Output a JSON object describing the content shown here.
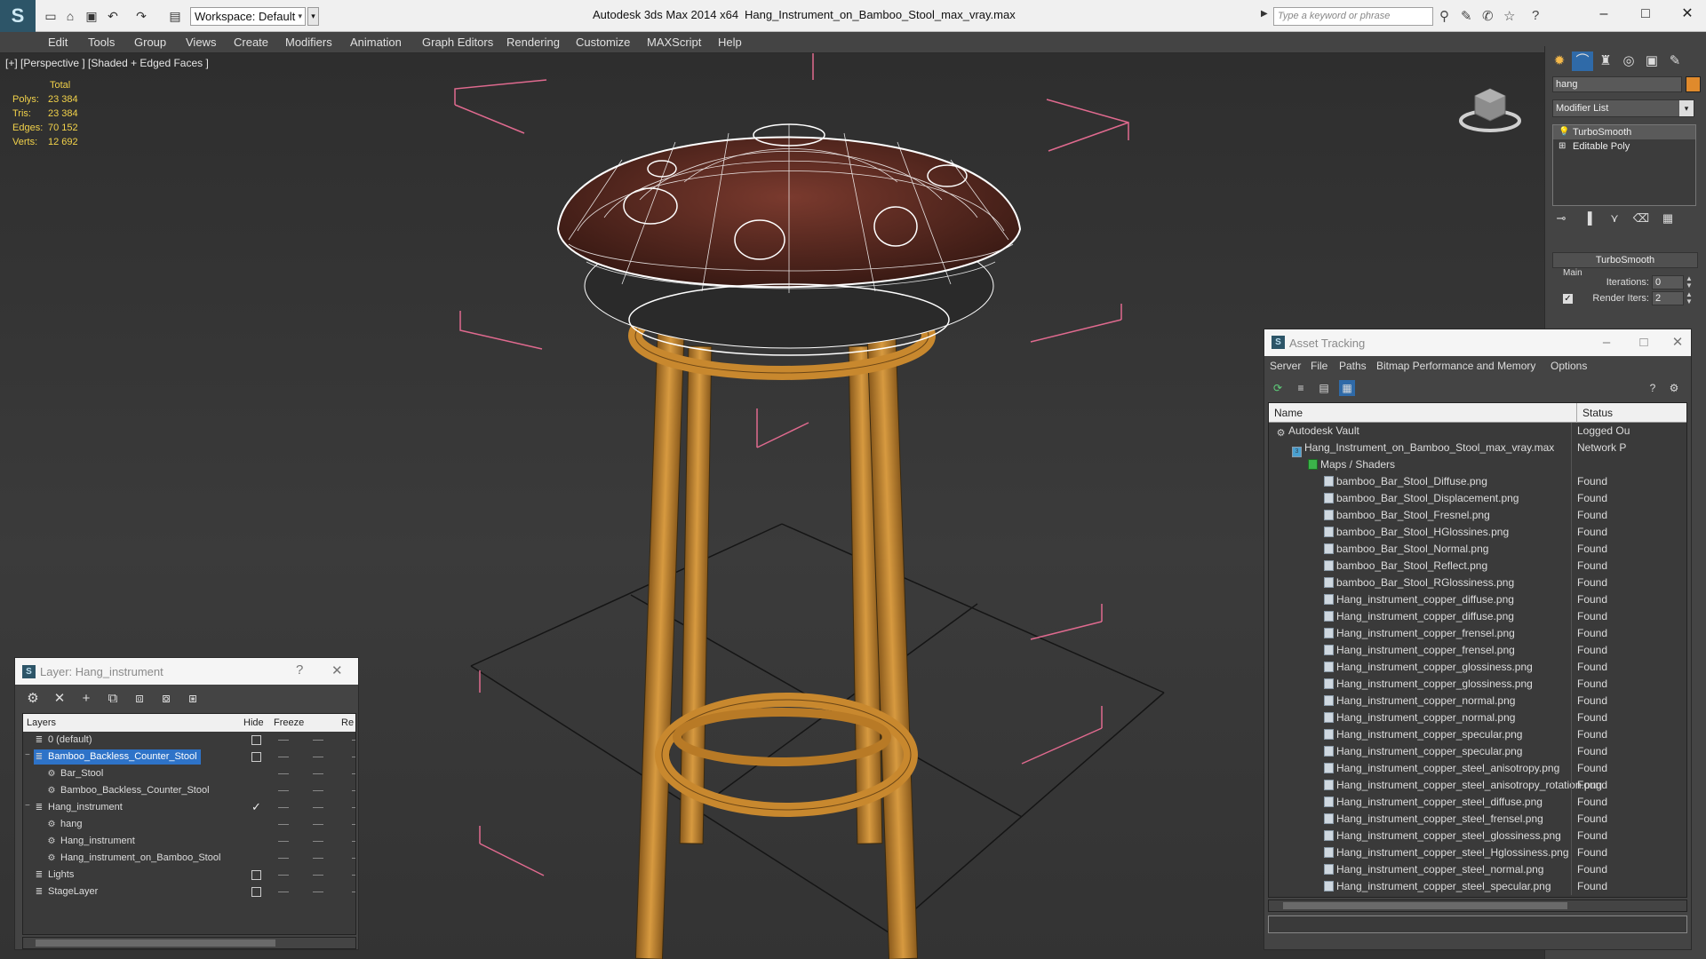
{
  "titlebar": {
    "app_title": "Autodesk 3ds Max  2014 x64",
    "file_title": "Hang_Instrument_on_Bamboo_Stool_max_vray.max",
    "workspace": "Workspace: Default",
    "search_placeholder": "Type a keyword or phrase"
  },
  "menubar": [
    "Edit",
    "Tools",
    "Group",
    "Views",
    "Create",
    "Modifiers",
    "Animation",
    "Graph Editors",
    "Rendering",
    "Customize",
    "MAXScript",
    "Help"
  ],
  "viewport": {
    "label": "[+] [Perspective ] [Shaded + Edged Faces ]",
    "stats_header": "Total",
    "stats": [
      {
        "label": "Polys:",
        "value": "23 384"
      },
      {
        "label": "Tris:",
        "value": "23 384"
      },
      {
        "label": "Edges:",
        "value": "70 152"
      },
      {
        "label": "Verts:",
        "value": "12 692"
      }
    ],
    "colors": {
      "wire": "#ffffff",
      "shell": "#5a2a22",
      "bamboo": "#c8882e",
      "bbox": "#e06a8f",
      "grid": "#161616"
    }
  },
  "command_panel": {
    "object_name": "hang",
    "modifier_list": "Modifier List",
    "stack": [
      "TurboSmooth",
      "Editable Poly"
    ],
    "rollout_title": "TurboSmooth",
    "main_label": "Main",
    "iterations_label": "Iterations:",
    "iterations_value": "0",
    "render_iters_label": "Render Iters:",
    "render_iters_value": "2",
    "object_color": "#e08a2c"
  },
  "asset_tracking": {
    "title": "Asset Tracking",
    "menu": [
      "Server",
      "File",
      "Paths",
      "Bitmap Performance and Memory",
      "Options"
    ],
    "columns": {
      "name": "Name",
      "status": "Status"
    },
    "rows": [
      {
        "name": "Autodesk Vault",
        "status": "Logged Ou",
        "indent": 0,
        "icon": "vault"
      },
      {
        "name": "Hang_Instrument_on_Bamboo_Stool_max_vray.max",
        "status": "Network P",
        "indent": 1,
        "icon": "max"
      },
      {
        "name": "Maps / Shaders",
        "status": "",
        "indent": 2,
        "icon": "maps"
      },
      {
        "name": "bamboo_Bar_Stool_Diffuse.png",
        "status": "Found",
        "indent": 3,
        "icon": "file"
      },
      {
        "name": "bamboo_Bar_Stool_Displacement.png",
        "status": "Found",
        "indent": 3,
        "icon": "file"
      },
      {
        "name": "bamboo_Bar_Stool_Fresnel.png",
        "status": "Found",
        "indent": 3,
        "icon": "file"
      },
      {
        "name": "bamboo_Bar_Stool_HGlossines.png",
        "status": "Found",
        "indent": 3,
        "icon": "file"
      },
      {
        "name": "bamboo_Bar_Stool_Normal.png",
        "status": "Found",
        "indent": 3,
        "icon": "file"
      },
      {
        "name": "bamboo_Bar_Stool_Reflect.png",
        "status": "Found",
        "indent": 3,
        "icon": "file"
      },
      {
        "name": "bamboo_Bar_Stool_RGlossiness.png",
        "status": "Found",
        "indent": 3,
        "icon": "file"
      },
      {
        "name": "Hang_instrument_copper_diffuse.png",
        "status": "Found",
        "indent": 3,
        "icon": "file"
      },
      {
        "name": "Hang_instrument_copper_diffuse.png",
        "status": "Found",
        "indent": 3,
        "icon": "file"
      },
      {
        "name": "Hang_instrument_copper_frensel.png",
        "status": "Found",
        "indent": 3,
        "icon": "file"
      },
      {
        "name": "Hang_instrument_copper_frensel.png",
        "status": "Found",
        "indent": 3,
        "icon": "file"
      },
      {
        "name": "Hang_instrument_copper_glossiness.png",
        "status": "Found",
        "indent": 3,
        "icon": "file"
      },
      {
        "name": "Hang_instrument_copper_glossiness.png",
        "status": "Found",
        "indent": 3,
        "icon": "file"
      },
      {
        "name": "Hang_instrument_copper_normal.png",
        "status": "Found",
        "indent": 3,
        "icon": "file"
      },
      {
        "name": "Hang_instrument_copper_normal.png",
        "status": "Found",
        "indent": 3,
        "icon": "file"
      },
      {
        "name": "Hang_instrument_copper_specular.png",
        "status": "Found",
        "indent": 3,
        "icon": "file"
      },
      {
        "name": "Hang_instrument_copper_specular.png",
        "status": "Found",
        "indent": 3,
        "icon": "file"
      },
      {
        "name": "Hang_instrument_copper_steel_anisotropy.png",
        "status": "Found",
        "indent": 3,
        "icon": "file"
      },
      {
        "name": "Hang_instrument_copper_steel_anisotropy_rotation.png",
        "status": "Found",
        "indent": 3,
        "icon": "file"
      },
      {
        "name": "Hang_instrument_copper_steel_diffuse.png",
        "status": "Found",
        "indent": 3,
        "icon": "file"
      },
      {
        "name": "Hang_instrument_copper_steel_frensel.png",
        "status": "Found",
        "indent": 3,
        "icon": "file"
      },
      {
        "name": "Hang_instrument_copper_steel_glossiness.png",
        "status": "Found",
        "indent": 3,
        "icon": "file"
      },
      {
        "name": "Hang_instrument_copper_steel_Hglossiness.png",
        "status": "Found",
        "indent": 3,
        "icon": "file"
      },
      {
        "name": "Hang_instrument_copper_steel_normal.png",
        "status": "Found",
        "indent": 3,
        "icon": "file"
      },
      {
        "name": "Hang_instrument_copper_steel_specular.png",
        "status": "Found",
        "indent": 3,
        "icon": "file"
      }
    ]
  },
  "layer_explorer": {
    "title": "Layer: Hang_instrument",
    "columns": {
      "layers": "Layers",
      "hide": "Hide",
      "freeze": "Freeze",
      "render": "Re"
    },
    "rows": [
      {
        "name": "0 (default)",
        "indent": 0,
        "icon": "layer",
        "hide": "box",
        "selected": false
      },
      {
        "name": "Bamboo_Backless_Counter_Stool",
        "indent": 0,
        "icon": "layer",
        "hide": "box",
        "selected": true,
        "expander": "-"
      },
      {
        "name": "Bar_Stool",
        "indent": 1,
        "icon": "object",
        "hide": "none",
        "selected": false
      },
      {
        "name": "Bamboo_Backless_Counter_Stool",
        "indent": 1,
        "icon": "object",
        "hide": "none",
        "selected": false
      },
      {
        "name": "Hang_instrument",
        "indent": 0,
        "icon": "layer",
        "hide": "check",
        "selected": false,
        "expander": "-"
      },
      {
        "name": "hang",
        "indent": 1,
        "icon": "object",
        "hide": "none",
        "selected": false
      },
      {
        "name": "Hang_instrument",
        "indent": 1,
        "icon": "object",
        "hide": "none",
        "selected": false
      },
      {
        "name": "Hang_instrument_on_Bamboo_Stool",
        "indent": 1,
        "icon": "object",
        "hide": "none",
        "selected": false
      },
      {
        "name": "Lights",
        "indent": 0,
        "icon": "layer",
        "hide": "box",
        "selected": false
      },
      {
        "name": "StageLayer",
        "indent": 0,
        "icon": "layer",
        "hide": "box",
        "selected": false
      }
    ]
  }
}
